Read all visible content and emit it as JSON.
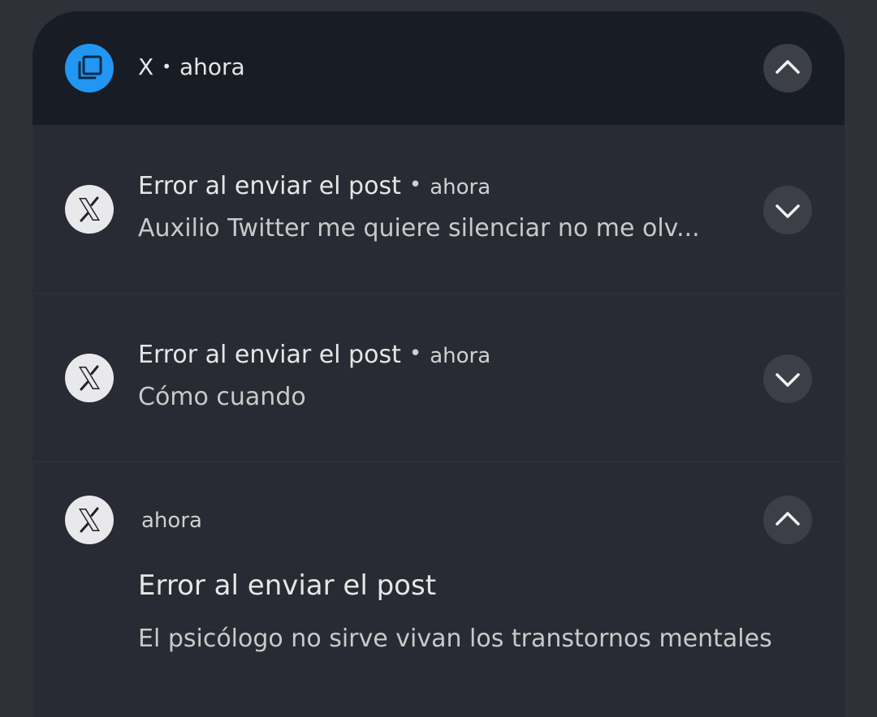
{
  "group": {
    "app_name": "X",
    "separator": "•",
    "time": "ahora"
  },
  "notifications": [
    {
      "title": "Error al enviar el post",
      "separator": "•",
      "time": "ahora",
      "body": "Auxilio Twitter me quiere silenciar no me olv..."
    },
    {
      "title": "Error al enviar el post",
      "separator": "•",
      "time": "ahora",
      "body": "Cómo cuando"
    },
    {
      "time": "ahora",
      "title": "Error al enviar el post",
      "body": "El psicólogo no sirve vivan los transtornos mentales"
    }
  ],
  "colors": {
    "background": "#2e3138",
    "panel": "#282b33",
    "header": "#181c25",
    "accent_blue": "#2196f3",
    "chevron_bg": "#3c3f47"
  },
  "icons": {
    "group": "stacked-windows-icon",
    "app": "x-logo-icon",
    "collapse": "chevron-up-icon",
    "expand": "chevron-down-icon"
  }
}
